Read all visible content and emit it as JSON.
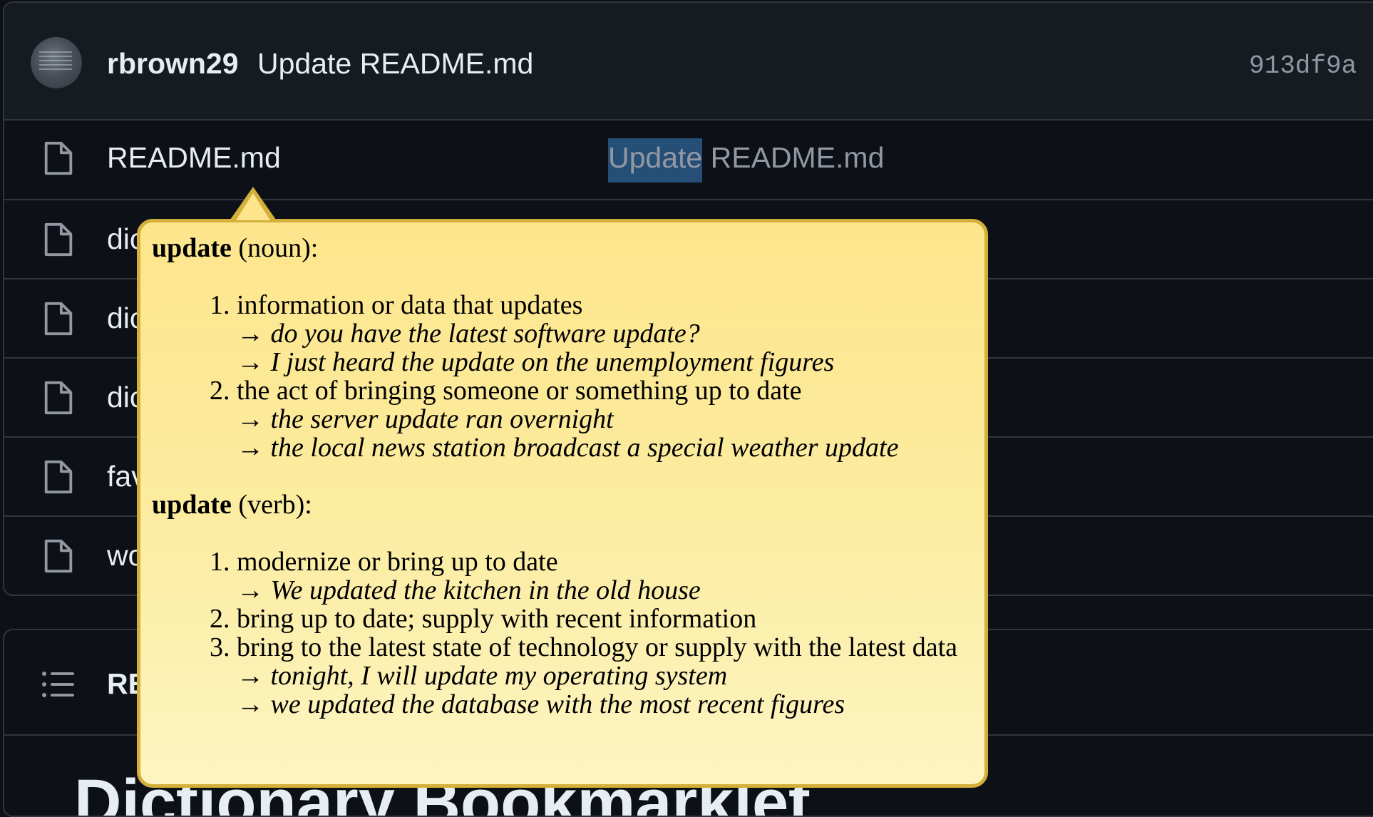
{
  "commit": {
    "author": "rbrown29",
    "message": "Update README.md",
    "hash": "913df9a"
  },
  "files": [
    {
      "name": "README.md",
      "commit_highlight": "Update",
      "commit_rest": " README.md"
    },
    {
      "name": "dic"
    },
    {
      "name": "dic"
    },
    {
      "name": "dic"
    },
    {
      "name": "fav"
    },
    {
      "name": "wo"
    }
  ],
  "readme": {
    "title": "RE",
    "heading": "Dictionary Bookmarklet"
  },
  "popup": {
    "noun": {
      "word": "update",
      "pos": " (noun):",
      "senses": [
        {
          "def": "information or data that updates",
          "examples": [
            "→ do you have the latest software update?",
            "→ I just heard the update on the unemployment figures"
          ]
        },
        {
          "def": "the act of bringing someone or something up to date",
          "examples": [
            "→ the server update ran overnight",
            "→ the local news station broadcast a special weather update"
          ]
        }
      ]
    },
    "verb": {
      "word": "update",
      "pos": " (verb):",
      "senses": [
        {
          "def": "modernize or bring up to date",
          "examples": [
            "→ We updated the kitchen in the old house"
          ]
        },
        {
          "def": "bring up to date; supply with recent information",
          "examples": []
        },
        {
          "def": "bring to the latest state of technology or supply with the latest data",
          "examples": [
            "→ tonight, I will update my operating system",
            "→ we updated the database with the most recent figures"
          ]
        }
      ]
    }
  }
}
